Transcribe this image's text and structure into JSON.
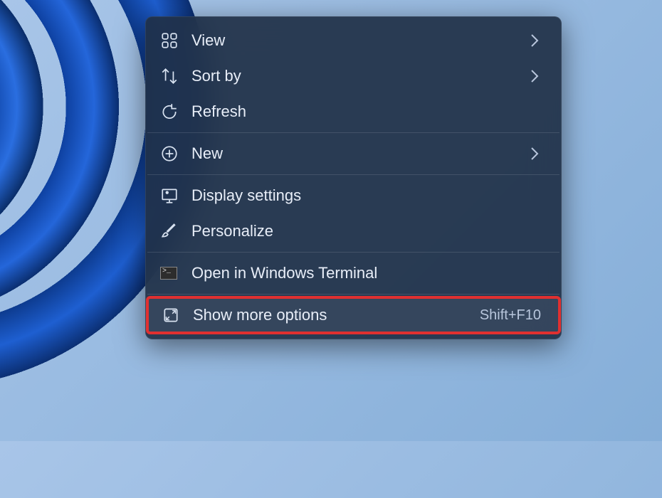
{
  "menu": {
    "items": [
      {
        "label": "View",
        "has_submenu": true
      },
      {
        "label": "Sort by",
        "has_submenu": true
      },
      {
        "label": "Refresh",
        "has_submenu": false
      },
      {
        "label": "New",
        "has_submenu": true
      },
      {
        "label": "Display settings",
        "has_submenu": false
      },
      {
        "label": "Personalize",
        "has_submenu": false
      },
      {
        "label": "Open in Windows Terminal",
        "has_submenu": false
      },
      {
        "label": "Show more options",
        "has_submenu": false,
        "shortcut": "Shift+F10",
        "highlighted": true
      }
    ]
  }
}
